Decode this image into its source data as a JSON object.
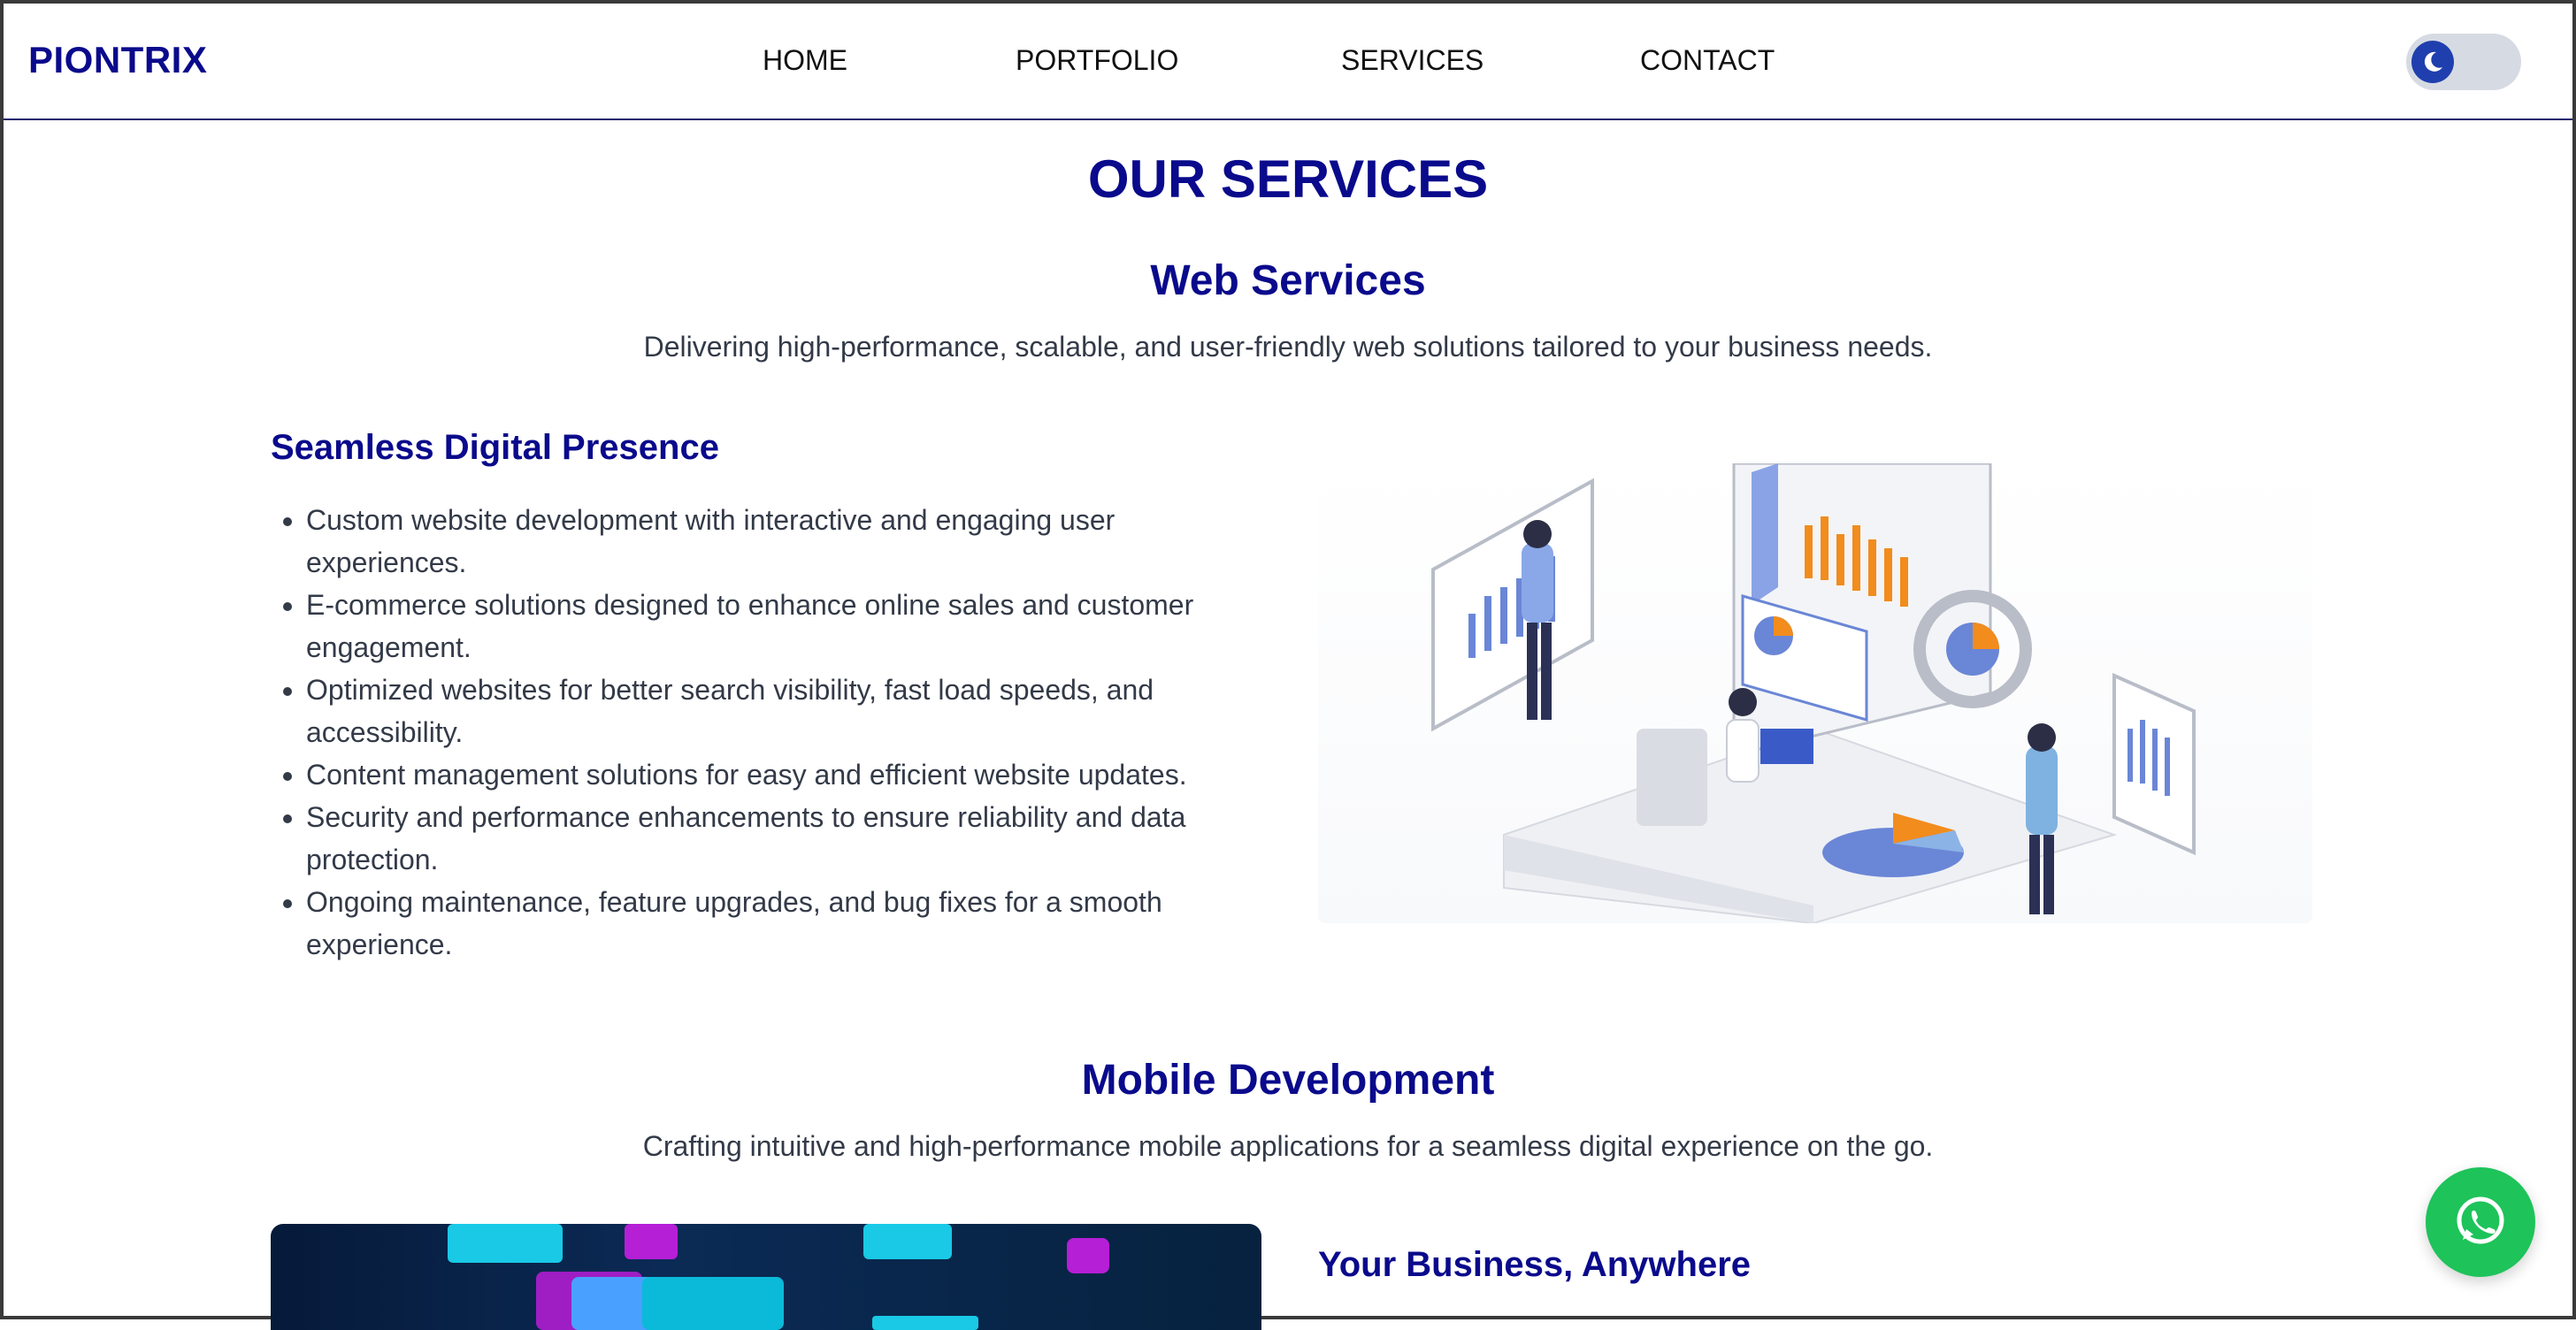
{
  "navbar": {
    "brand": "PIONTRIX",
    "links": [
      "HOME",
      "PORTFOLIO",
      "SERVICES",
      "CONTACT"
    ],
    "theme_toggle_icon": "moon-icon"
  },
  "page": {
    "title": "OUR SERVICES"
  },
  "web_services": {
    "title": "Web Services",
    "description": "Delivering high-performance, scalable, and user-friendly web solutions tailored to your business needs.",
    "sub_heading": "Seamless Digital Presence",
    "features": [
      "Custom website development with interactive and engaging user experiences.",
      "E-commerce solutions designed to enhance online sales and customer engagement.",
      "Optimized websites for better search visibility, fast load speeds, and accessibility.",
      "Content management solutions for easy and efficient website updates.",
      "Security and performance enhancements to ensure reliability and data protection.",
      "Ongoing maintenance, feature upgrades, and bug fixes for a smooth experience."
    ],
    "illustration_icon": "isometric-analytics-illustration"
  },
  "mobile_development": {
    "title": "Mobile Development",
    "description": "Crafting intuitive and high-performance mobile applications for a seamless digital experience on the go.",
    "sub_heading": "Your Business, Anywhere",
    "image_icon": "mobile-app-illustration"
  },
  "floating": {
    "whatsapp_icon": "whatsapp-icon"
  },
  "colors": {
    "brand_blue": "#0a0a8c",
    "whatsapp_green": "#1ec35a",
    "toggle_knob": "#1f3fae"
  }
}
